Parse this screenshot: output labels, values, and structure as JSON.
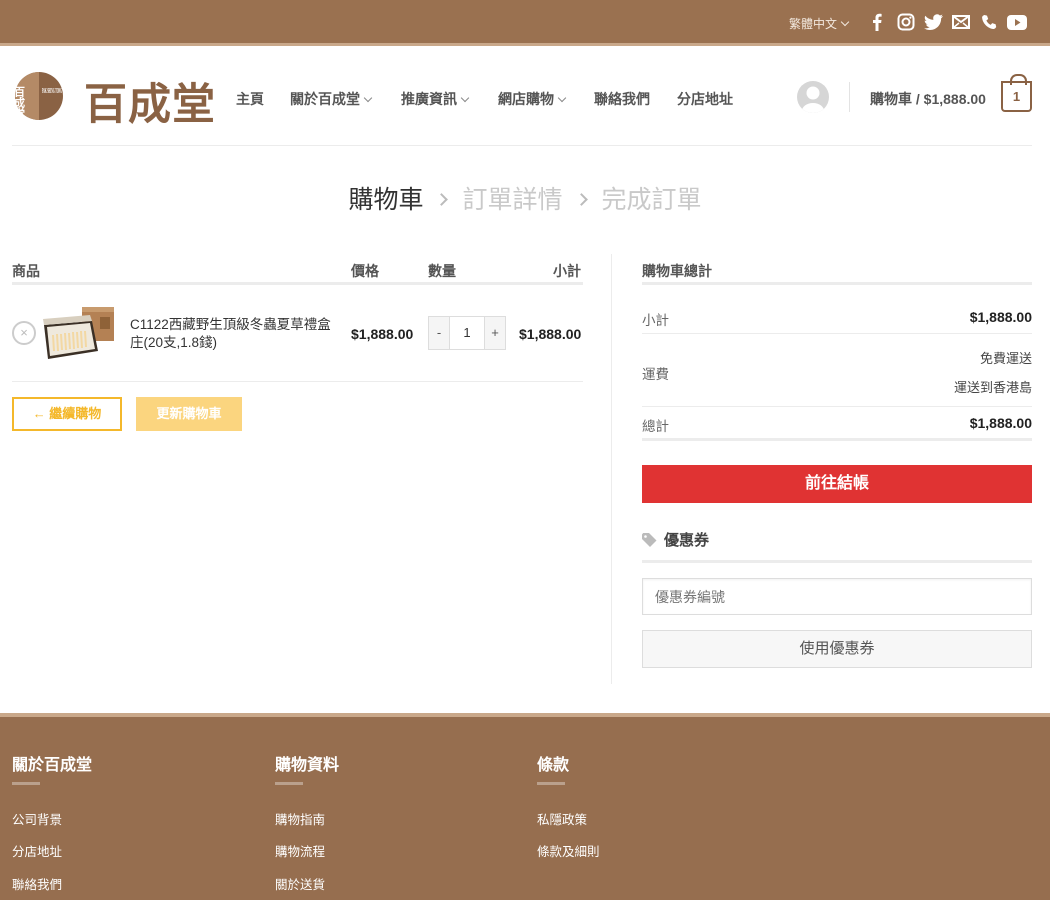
{
  "topbar": {
    "language": "繁體中文",
    "social_icons": [
      "facebook-icon",
      "instagram-icon",
      "twitter-icon",
      "email-icon",
      "phone-icon",
      "youtube-icon"
    ]
  },
  "header": {
    "logo_text": "百成堂",
    "logo_mark_text": "百成堂",
    "logo_mark_latin": "PAK SHING TONG",
    "nav": [
      "主頁",
      "關於百成堂",
      "推廣資訊",
      "網店購物",
      "聯絡我們",
      "分店地址"
    ],
    "cart_label": "購物車 / $1,888.00",
    "cart_count": "1"
  },
  "steps": [
    "購物車",
    "訂單詳情",
    "完成訂單"
  ],
  "cart": {
    "headers": {
      "product": "商品",
      "price": "價格",
      "quantity": "數量",
      "subtotal": "小計"
    },
    "items": [
      {
        "name": "C1122西藏野生頂級冬蟲夏草禮盒庄(20支,1.8錢)",
        "price": "$1,888.00",
        "quantity": "1",
        "subtotal": "$1,888.00"
      }
    ],
    "continue_label": "← 繼續購物",
    "update_label": "更新購物車"
  },
  "totals": {
    "title": "購物車總計",
    "subtotal_label": "小計",
    "subtotal_value": "$1,888.00",
    "shipping_label": "運費",
    "shipping_value": "免費運送",
    "shipping_dest": "運送到香港島",
    "total_label": "總計",
    "total_value": "$1,888.00",
    "checkout_label": "前往結帳"
  },
  "coupon": {
    "title": "優惠券",
    "placeholder": "優惠券編號",
    "apply_label": "使用優惠券"
  },
  "footer": {
    "columns": [
      {
        "title": "關於百成堂",
        "links": [
          "公司背景",
          "分店地址",
          "聯絡我們"
        ]
      },
      {
        "title": "購物資料",
        "links": [
          "購物指南",
          "購物流程",
          "關於送貨"
        ]
      },
      {
        "title": "條款",
        "links": [
          "私隱政策",
          "條款及細則"
        ]
      }
    ]
  },
  "colors": {
    "brand_brown": "#9a7150",
    "accent_red": "#e03333",
    "accent_yellow": "#f4b82b"
  }
}
